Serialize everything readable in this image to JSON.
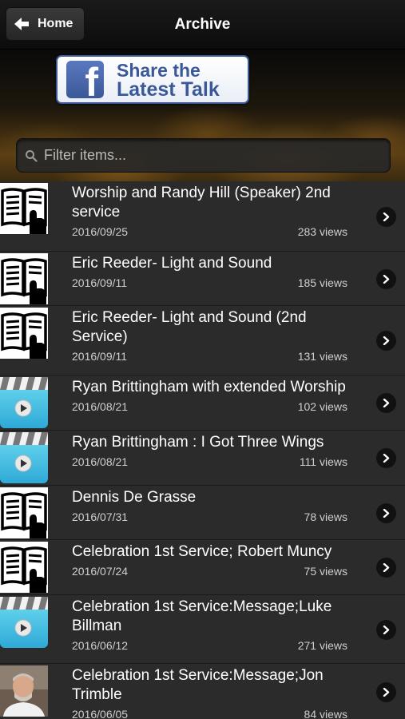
{
  "nav": {
    "title": "Archive",
    "home_label": "Home"
  },
  "banner": {
    "share_line1": "Share the",
    "share_line2": "Latest Talk",
    "fb_letter": "f"
  },
  "filter": {
    "placeholder": "Filter items...",
    "value": ""
  },
  "items": [
    {
      "title": "Worship and Randy Hill (Speaker) 2nd service",
      "date": "2016/09/25",
      "views": "283 views",
      "thumb": "book-icon"
    },
    {
      "title": "Eric Reeder- Light and Sound",
      "date": "2016/09/11",
      "views": "185 views",
      "thumb": "book-icon"
    },
    {
      "title": "Eric Reeder- Light and Sound (2nd Service)",
      "date": "2016/09/11",
      "views": "131 views",
      "thumb": "book-icon"
    },
    {
      "title": "Ryan Brittingham with extended Worship",
      "date": "2016/08/21",
      "views": "102 views",
      "thumb": "video-clapper-icon"
    },
    {
      "title": "Ryan Brittingham : I Got Three Wings",
      "date": "2016/08/21",
      "views": "111 views",
      "thumb": "video-clapper-icon"
    },
    {
      "title": "Dennis De Grasse",
      "date": "2016/07/31",
      "views": "78 views",
      "thumb": "book-icon"
    },
    {
      "title": "Celebration 1st Service; Robert Muncy",
      "date": "2016/07/24",
      "views": "75 views",
      "thumb": "book-icon"
    },
    {
      "title": "Celebration 1st Service:Message;Luke Billman",
      "date": "2016/06/12",
      "views": "271 views",
      "thumb": "video-clapper-icon"
    },
    {
      "title": "Celebration 1st Service:Message;Jon Trimble",
      "date": "2016/06/05",
      "views": "84 views",
      "thumb": "speaker-photo"
    }
  ],
  "colors": {
    "facebook_blue": "#3b5998",
    "row_bg": "#2b2b2b",
    "video_blue": "#3cbde3"
  }
}
